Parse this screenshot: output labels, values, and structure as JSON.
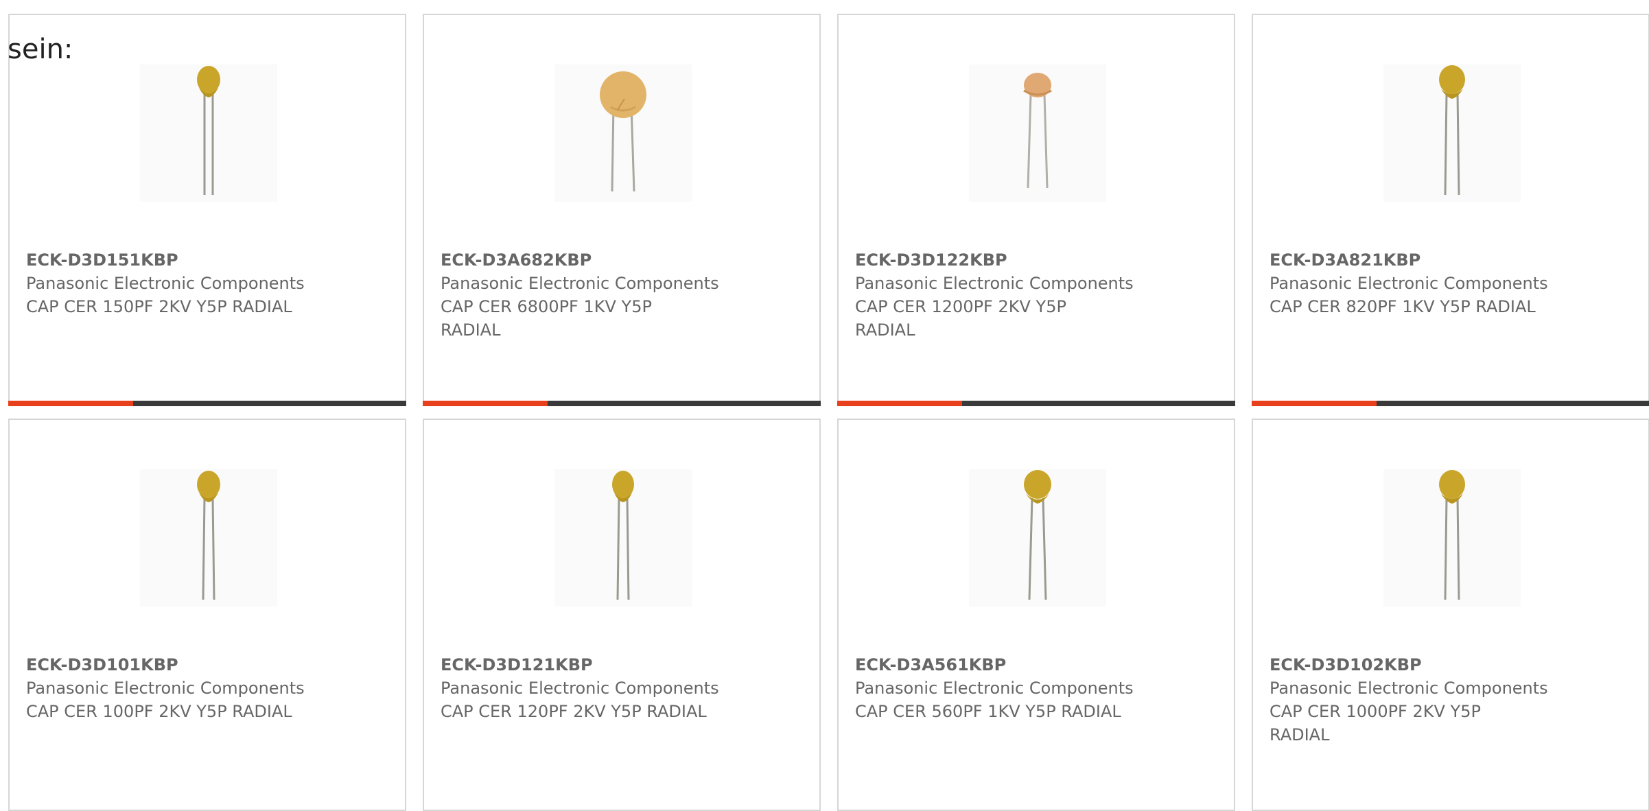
{
  "lead_text": "sein:",
  "accent_color": "#e8401c",
  "bar_color": "#3a3a3a",
  "products": [
    {
      "part_number": "ECK-D3D151KBP",
      "manufacturer": "Panasonic Electronic Components",
      "description": "CAP CER 150PF 2KV Y5P RADIAL",
      "image_icon": "ceramic-disc-capacitor-icon"
    },
    {
      "part_number": "ECK-D3A682KBP",
      "manufacturer": "Panasonic Electronic Components",
      "description": "CAP CER 6800PF 1KV Y5P RADIAL",
      "image_icon": "ceramic-disc-capacitor-large-icon"
    },
    {
      "part_number": "ECK-D3D122KBP",
      "manufacturer": "Panasonic Electronic Components",
      "description": "CAP CER 1200PF 2KV Y5P RADIAL",
      "image_icon": "ceramic-disc-capacitor-icon"
    },
    {
      "part_number": "ECK-D3A821KBP",
      "manufacturer": "Panasonic Electronic Components",
      "description": "CAP CER 820PF 1KV Y5P RADIAL",
      "image_icon": "ceramic-disc-capacitor-icon"
    },
    {
      "part_number": "ECK-D3D101KBP",
      "manufacturer": "Panasonic Electronic Components",
      "description": "CAP CER 100PF 2KV Y5P RADIAL",
      "image_icon": "ceramic-disc-capacitor-icon"
    },
    {
      "part_number": "ECK-D3D121KBP",
      "manufacturer": "Panasonic Electronic Components",
      "description": "CAP CER 120PF 2KV Y5P RADIAL",
      "image_icon": "ceramic-disc-capacitor-icon"
    },
    {
      "part_number": "ECK-D3A561KBP",
      "manufacturer": "Panasonic Electronic Components",
      "description": "CAP CER 560PF 1KV Y5P RADIAL",
      "image_icon": "ceramic-disc-capacitor-icon"
    },
    {
      "part_number": "ECK-D3D102KBP",
      "manufacturer": "Panasonic Electronic Components",
      "description": "CAP CER 1000PF 2KV Y5P RADIAL",
      "image_icon": "ceramic-disc-capacitor-icon"
    }
  ]
}
